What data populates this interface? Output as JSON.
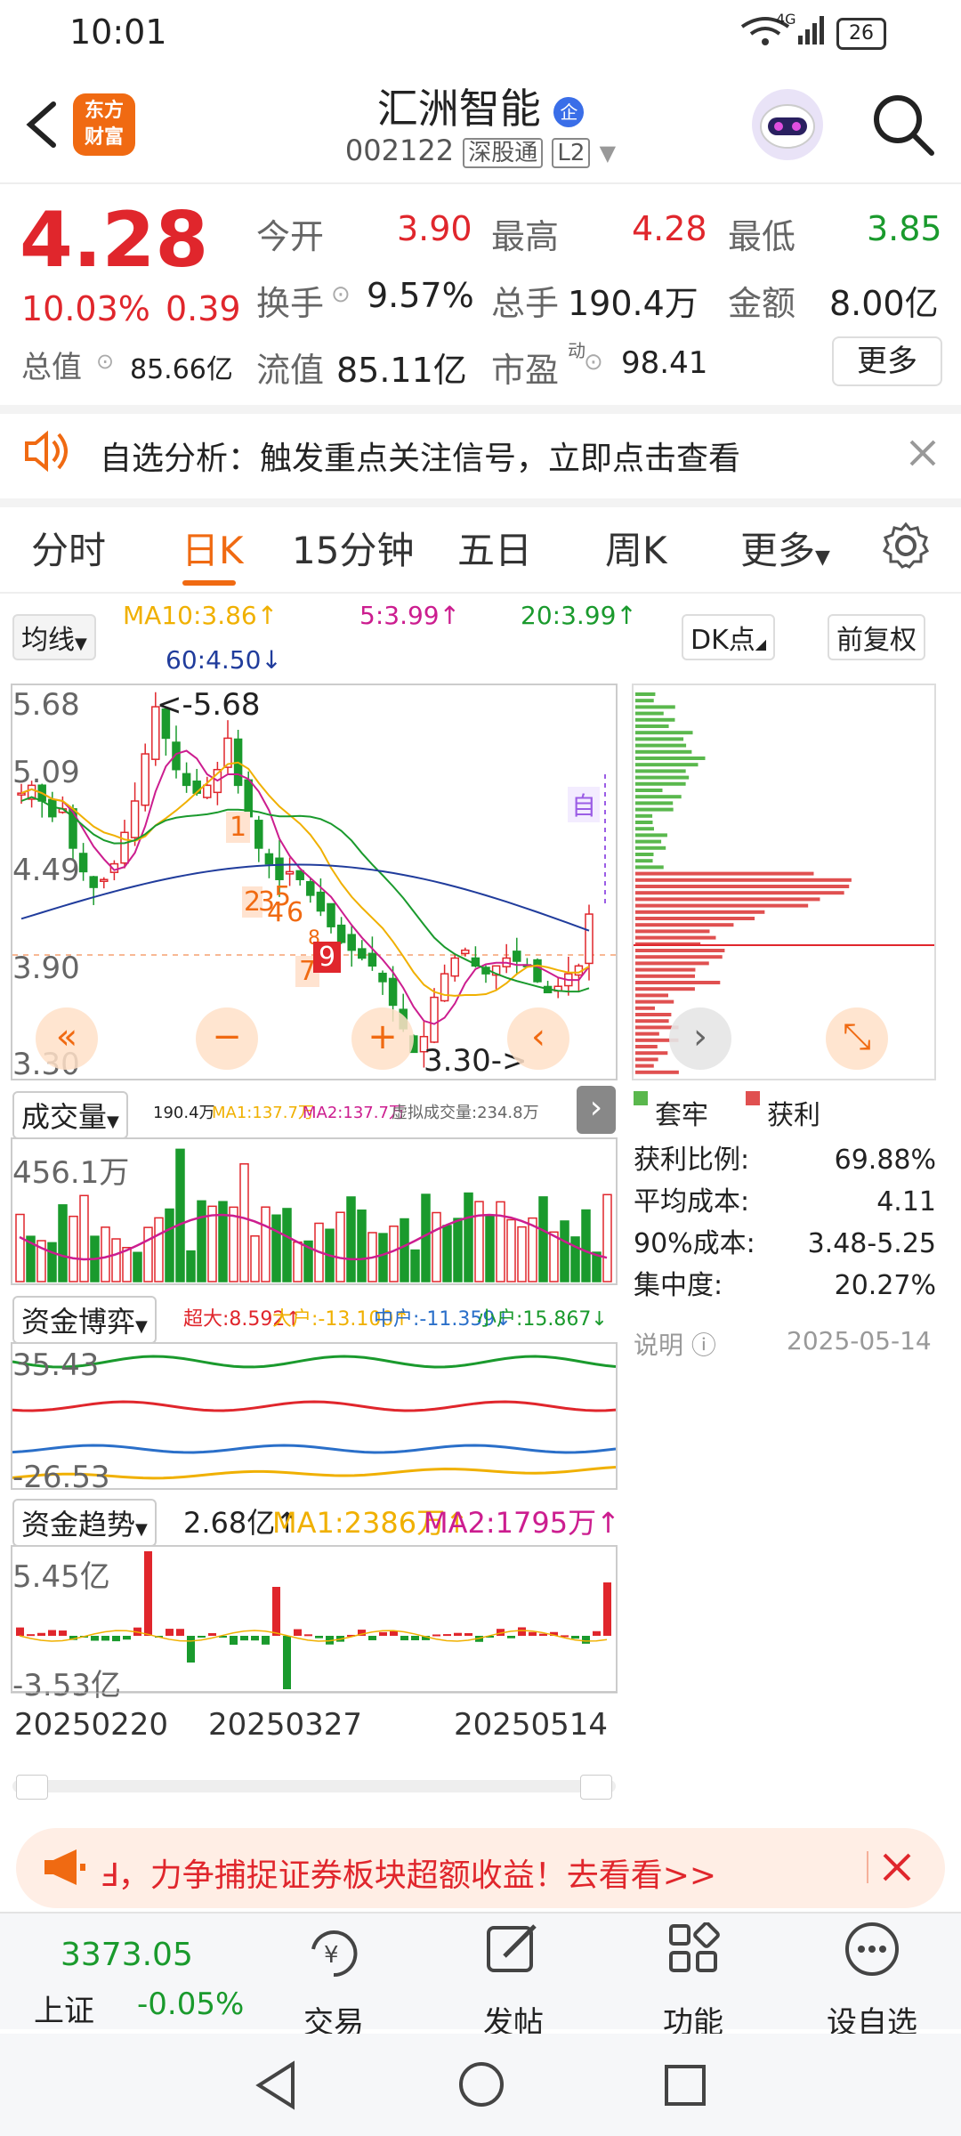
{
  "status_bar": {
    "time": "10:01",
    "network": "4G",
    "battery": "26"
  },
  "header": {
    "logo": "东方\n财富",
    "logo_line1": "东方",
    "logo_line2": "财富",
    "name": "汇洲智能",
    "badge": "企",
    "code": "002122",
    "tag1": "深股通",
    "tag2": "L2"
  },
  "quote": {
    "price": "4.28",
    "change_pct": "10.03%",
    "change": "0.39",
    "open_label": "今开",
    "open": "3.90",
    "high_label": "最高",
    "high": "4.28",
    "low_label": "最低",
    "low": "3.85",
    "turnover_label": "换手",
    "turnover": "9.57%",
    "volume_label": "总手",
    "volume": "190.4万",
    "amount_label": "金额",
    "amount": "8.00亿",
    "mktcap_label": "总值",
    "mktcap": "85.66亿",
    "float_label": "流值",
    "float_cap": "85.11亿",
    "pe_label": "市盈",
    "pe_sup": "动",
    "pe": "98.41",
    "more_label": "更多"
  },
  "banner": {
    "text": "自选分析：触发重点关注信号，立即点击查看"
  },
  "tabs": [
    "分时",
    "日K",
    "15分钟",
    "五日",
    "周K",
    "更多"
  ],
  "chart_header": {
    "ma_selector": "均线",
    "ma10": "MA10:3.86↑",
    "ma5": "5:3.99↑",
    "ma20": "20:3.99↑",
    "ma60": "60:4.50↓",
    "dk_button": "DK点",
    "adjust_button": "前复权"
  },
  "kline": {
    "y_labels": [
      "5.68",
      "5.09",
      "4.49",
      "3.90",
      "3.30"
    ],
    "max_marker": "<-5.68",
    "min_marker": "3.30->",
    "self_marker": "自",
    "signal_marks": [
      "1",
      "2",
      "3",
      "5",
      "4",
      "6",
      "7",
      "8",
      "9"
    ]
  },
  "volume_panel": {
    "selector": "成交量",
    "v": "190.4万",
    "ma1": "MA1:137.7万",
    "ma2": "MA2:137.7万",
    "virtual": "虚拟成交量:234.8万",
    "y_max": "456.1万"
  },
  "capital_panel": {
    "selector": "资金博弈",
    "super": "超大:8.592↑",
    "large": "大户:-13.100↑",
    "mid": "中户:-11.359↓",
    "small": "小户:15.867↓",
    "y_max": "35.43",
    "y_min": "-26.53"
  },
  "trend_panel": {
    "selector": "资金趋势",
    "v": "2.68亿↑",
    "ma1": "MA1:2386万↑",
    "ma2": "MA2:1795万↑",
    "y_max": "5.45亿",
    "y_min": "-3.53亿"
  },
  "dates": [
    "20250220",
    "20250327",
    "20250514"
  ],
  "chip_panel": {
    "legend_trapped": "套牢",
    "legend_profit": "获利",
    "rows": [
      {
        "k": "获利比例:",
        "v": "69.88%"
      },
      {
        "k": "平均成本:",
        "v": "4.11"
      },
      {
        "k": "90%成本:",
        "v": "3.48-5.25"
      },
      {
        "k": "集中度:",
        "v": "20.27%"
      }
    ],
    "note": "说明",
    "date": "2025-05-14"
  },
  "promo": {
    "text": "Ⅎ，力争捕捉证券板块超额收益！去看看>>"
  },
  "bottom_nav": {
    "index_value": "3373.05",
    "index_name": "上证",
    "index_change": "-0.05%",
    "items": [
      "交易",
      "发帖",
      "功能",
      "设自选"
    ]
  },
  "colors": {
    "up": "#e0262c",
    "down": "#1a9a2d",
    "accent": "#f06a12",
    "ma10": "#f0b000",
    "ma5": "#cc1d8f",
    "ma20": "#1a9a2d",
    "ma60": "#203c9c"
  }
}
